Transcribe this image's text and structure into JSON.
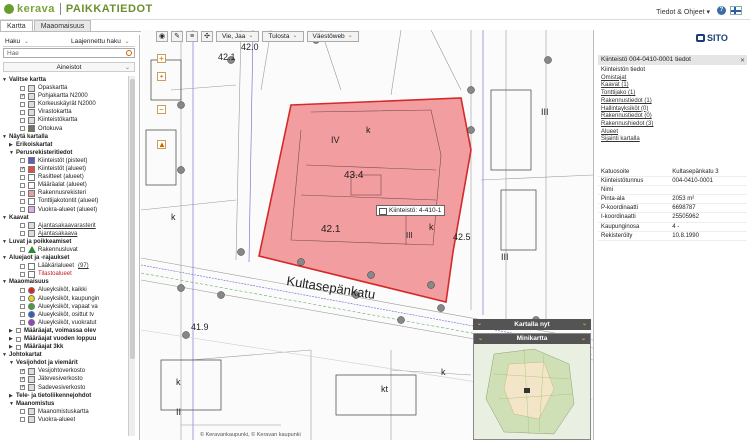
{
  "header": {
    "logo_text": "kerava",
    "app_title": "PAIKKATIEDOT",
    "user_menu": "Tiedot & Ohjeet ▾"
  },
  "tabs": [
    {
      "label": "Kartta",
      "active": true
    },
    {
      "label": "Maaomaisuus",
      "active": false
    }
  ],
  "sidebar": {
    "search_tab": "Haku",
    "advanced_search_tab": "Laajennettu haku",
    "search_placeholder": "Hae",
    "layers_dropdown": "Aineistot",
    "tree": [
      {
        "level": 0,
        "label": "Valitse kartta",
        "bold": true,
        "arrow": "▼"
      },
      {
        "level": 2,
        "label": "Opaskartta",
        "checkbox": false,
        "swatch": "#ddd"
      },
      {
        "level": 2,
        "label": "Pohjakartta N2000",
        "checkbox": true,
        "swatch": "#ddd"
      },
      {
        "level": 2,
        "label": "Korkeuskäyrät N2000",
        "checkbox": false,
        "swatch": "#ddd"
      },
      {
        "level": 2,
        "label": "Virastokartta",
        "checkbox": false,
        "swatch": "#ddd"
      },
      {
        "level": 2,
        "label": "Kiinteistökartta",
        "checkbox": false,
        "swatch": "#ddd"
      },
      {
        "level": 2,
        "label": "Ortokuva",
        "checkbox": false,
        "swatch": "#6d7a5a"
      },
      {
        "level": 0,
        "label": "Näytä kartalla",
        "bold": true,
        "arrow": "▼"
      },
      {
        "level": 1,
        "label": "Erikoiskartat",
        "bold": true,
        "arrow": "▶"
      },
      {
        "level": 1,
        "label": "Perusrekisteritiedot",
        "bold": true,
        "arrow": "▼"
      },
      {
        "level": 2,
        "label": "Kiinteistöt (pisteet)",
        "checkbox": false,
        "swatch": "#5a5fc8"
      },
      {
        "level": 2,
        "label": "Kiinteistöt (alueet)",
        "checkbox": true,
        "swatch": "#e84a4a"
      },
      {
        "level": 2,
        "label": "Rasitteet (alueet)",
        "checkbox": false,
        "swatch": "#fff"
      },
      {
        "level": 2,
        "label": "Määräalat (alueet)",
        "checkbox": false,
        "swatch": "#fff"
      },
      {
        "level": 2,
        "label": "Rakennusrekisteri",
        "checkbox": false,
        "swatch": "#e8a0a0"
      },
      {
        "level": 2,
        "label": "Tonttijakotontit (alueet)",
        "checkbox": false,
        "swatch": "#fff"
      },
      {
        "level": 2,
        "label": "Vuokra-alueet (alueet)",
        "checkbox": false,
        "swatch": "#d8b0e8"
      },
      {
        "level": 0,
        "label": "Kaavat",
        "bold": true,
        "arrow": "▼"
      },
      {
        "level": 2,
        "label": "Ajantasakaavarasterit",
        "checkbox": false,
        "swatch": "#ddd",
        "link": true
      },
      {
        "level": 2,
        "label": "Ajantasakaava",
        "checkbox": false,
        "swatch": "#ddd",
        "link": true
      },
      {
        "level": 0,
        "label": "Luvat ja poikkeamiset",
        "bold": true,
        "arrow": "▼"
      },
      {
        "level": 2,
        "label": "Rakennusluvat",
        "checkbox": false,
        "swatch": "triangle"
      },
      {
        "level": 0,
        "label": "Aluejaot ja -rajaukset",
        "bold": true,
        "arrow": "▼"
      },
      {
        "level": 2,
        "label": "Lääkärialueet",
        "checkbox": false,
        "swatch": "#fff",
        "suffix": " (97)"
      },
      {
        "level": 2,
        "label": "Tilastoalueet",
        "checkbox": false,
        "swatch": "#fff",
        "red": true
      },
      {
        "level": 0,
        "label": "Maaomaisuus",
        "bold": true,
        "arrow": "▼"
      },
      {
        "level": 2,
        "label": "Alueyksiköt, kaikki",
        "checkbox": false,
        "swatch": "circle:#e02020"
      },
      {
        "level": 2,
        "label": "Alueyksiköt, kaupungin",
        "checkbox": false,
        "swatch": "circle:#f0d020"
      },
      {
        "level": 2,
        "label": "Alueyksiköt, vapaat va",
        "checkbox": false,
        "swatch": "circle:#40a040"
      },
      {
        "level": 2,
        "label": "Alueyksiköt, osittut tv",
        "checkbox": false,
        "swatch": "circle:#3060c0"
      },
      {
        "level": 2,
        "label": "Alueyksiköt, vuokratut",
        "checkbox": false,
        "swatch": "circle:#a040c0"
      },
      {
        "level": 1,
        "label": "Määräajat, voimassa olev",
        "bold": true,
        "arrow": "▶",
        "checkbox": false
      },
      {
        "level": 1,
        "label": "Määräajat vuoden loppuu",
        "bold": true,
        "arrow": "▶",
        "checkbox": false
      },
      {
        "level": 1,
        "label": "Määräajat 3kk",
        "bold": true,
        "arrow": "▶",
        "checkbox": false
      },
      {
        "level": 0,
        "label": "Johtokartat",
        "bold": true,
        "arrow": "▼"
      },
      {
        "level": 1,
        "label": "Vesijohdot ja viemärit",
        "bold": true,
        "arrow": "▼"
      },
      {
        "level": 2,
        "label": "Vesijohtoverkosto",
        "checkbox": true,
        "swatch": "#ddd"
      },
      {
        "level": 2,
        "label": "Jätevesiverkosto",
        "checkbox": true,
        "swatch": "#ddd"
      },
      {
        "level": 2,
        "label": "Sadevesiverkosto",
        "checkbox": true,
        "swatch": "#ddd"
      },
      {
        "level": 1,
        "label": "Tele- ja tietoliikennejohdot",
        "bold": true,
        "arrow": "▶"
      },
      {
        "level": 1,
        "label": "Maanomistus",
        "bold": true,
        "arrow": "▼"
      },
      {
        "level": 2,
        "label": "Maanomistuskartta",
        "checkbox": false,
        "swatch": "#ddd"
      },
      {
        "level": 2,
        "label": "Vuokra-alueet",
        "checkbox": false,
        "swatch": "#ddd"
      }
    ]
  },
  "toolbar": {
    "vie_jaa": "Vie, Jaa",
    "tulosta": "Tulosta",
    "vaestoweb": "Väestöweb"
  },
  "map": {
    "street_name": "Kultasepänkatu",
    "tooltip": "Kiinteistö: 4-410-1",
    "area_labels": [
      "42.1",
      "43.4",
      "42.1",
      "42.5",
      "42.0",
      "41.9"
    ],
    "zone_labels": [
      "IV",
      "k",
      "III",
      "k",
      "k",
      "k",
      "kt",
      "III",
      "II",
      "k",
      "III"
    ],
    "copyright": "© Keravankaupunki, © Keravan kaupunki"
  },
  "overlays": {
    "kartalla_nyt": "Kartalla nyt",
    "minikartta": "Minikartta"
  },
  "info_panel": {
    "brand": "SITO",
    "title": "Kiinteistö 004-0410-0001 tiedot",
    "links": [
      {
        "text": "Kiinteistön tiedot",
        "link": false
      },
      {
        "text": "Omistajat",
        "link": true
      },
      {
        "text": "Kaavat (1)",
        "link": true
      },
      {
        "text": "Tonttijako (1)",
        "link": true
      },
      {
        "text": "Rakennustiedot (1)",
        "link": true
      },
      {
        "text": "Hallintayksiköt (0)",
        "link": true
      },
      {
        "text": "Rakennustiedot (0)",
        "link": true
      },
      {
        "text": "Rakennushiedot (3)",
        "link": true
      },
      {
        "text": "Alueet",
        "link": true
      },
      {
        "text": "Sijainti kartalla",
        "link": true
      }
    ],
    "table": [
      [
        "Katuosoite",
        "Kultasepänkatu 3"
      ],
      [
        "Kiinteistötunnus",
        "004-0410-0001"
      ],
      [
        "Nimi",
        ""
      ],
      [
        "Pinta-ala",
        "2053 m²"
      ],
      [
        "P-koordinaatti",
        "6698787"
      ],
      [
        "I-koordinaatti",
        "25505962"
      ],
      [
        "Kaupunginosa",
        "4 -"
      ],
      [
        "Rekisteröity",
        "10.8.1990"
      ]
    ]
  }
}
